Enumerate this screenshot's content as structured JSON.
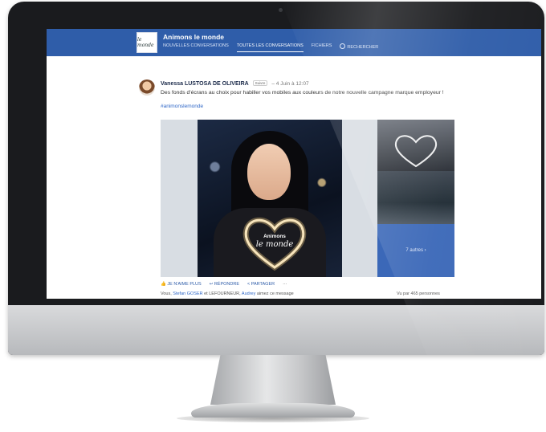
{
  "app": {
    "group_name": "Animons le monde",
    "logo_text": "le monde",
    "nav": [
      "NOUVELLES CONVERSATIONS",
      "TOUTES LES CONVERSATIONS",
      "FICHIERS",
      "RECHERCHER"
    ]
  },
  "post": {
    "author": "Vanessa LUSTOSA DE OLIVEIRA",
    "badge": "Suivre",
    "date": "– 4 Juin à 12:07",
    "text": "Des fonds d'écrans au choix pour habiller vos mobiles aux couleurs de notre nouvelle campagne marque employeur !",
    "hashtag": "#animonslemonde",
    "photo_heart_line1": "Animons",
    "photo_heart_line2": "le monde",
    "more_photos": "7 autres ›",
    "actions": [
      "👍 JE N'AIME PLUS",
      "↩ RÉPONDRE",
      "< PARTAGER",
      "···"
    ],
    "likers_prefix": "Vous,",
    "liker_1": "Stefan GOSER",
    "likers_mid": "et LEFOURNEUR,",
    "liker_2": "Audrey",
    "likers_suffix": "aimez ce message",
    "seen_by": "Vu par 465 personnes"
  },
  "colors": {
    "header": "#2f5da9",
    "link": "#2f67c7",
    "bezel": "#1a1b1e"
  }
}
